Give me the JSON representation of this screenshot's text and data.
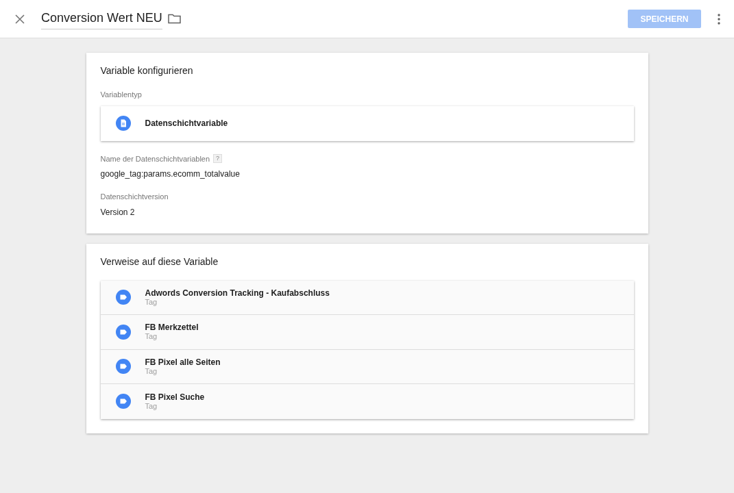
{
  "header": {
    "title": "Conversion Wert NEU",
    "save_button": {
      "label": "SPEICHERN",
      "disabled": true
    }
  },
  "config": {
    "title": "Variable konfigurieren",
    "type_label": "Variablentyp",
    "type_value": "Datenschichtvariable",
    "fields": [
      {
        "label": "Name der Datenschichtvariablen",
        "help": "?",
        "value": "google_tag:params.ecomm_totalvalue"
      },
      {
        "label": "Datenschichtversion",
        "value": "Version 2"
      }
    ]
  },
  "references": {
    "title": "Verweise auf diese Variable",
    "items": [
      {
        "name": "Adwords Conversion Tracking - Kaufabschluss",
        "type": "Tag"
      },
      {
        "name": "FB Merkzettel",
        "type": "Tag"
      },
      {
        "name": "FB Pixel alle Seiten",
        "type": "Tag"
      },
      {
        "name": "FB Pixel Suche",
        "type": "Tag"
      }
    ]
  }
}
